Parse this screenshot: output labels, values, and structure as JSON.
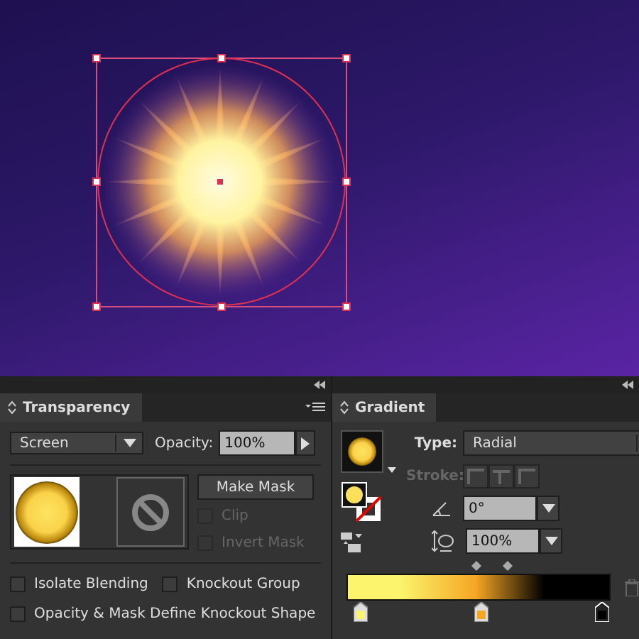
{
  "transparency": {
    "title": "Transparency",
    "blend_mode": "Screen",
    "opacity_label": "Opacity:",
    "opacity": "100%",
    "make_mask": "Make Mask",
    "mask_options": [
      {
        "label": "Clip",
        "checked": false,
        "disabled": true
      },
      {
        "label": "Invert Mask",
        "checked": false,
        "disabled": true
      }
    ],
    "options": [
      {
        "label": "Isolate Blending",
        "checked": false
      },
      {
        "label": "Knockout Group",
        "checked": false
      },
      {
        "label": "Opacity & Mask Define Knockout Shape",
        "checked": false
      }
    ]
  },
  "gradient": {
    "title": "Gradient",
    "type_label": "Type:",
    "type": "Radial",
    "stroke_label": "Stroke:",
    "stroke_disabled": true,
    "angle": "0°",
    "aspect": "100%",
    "stops": [
      {
        "color": "#fbf46c",
        "selected": false
      },
      {
        "color": "#f5a623",
        "selected": false
      },
      {
        "color": "#000000",
        "selected": true
      }
    ]
  }
}
